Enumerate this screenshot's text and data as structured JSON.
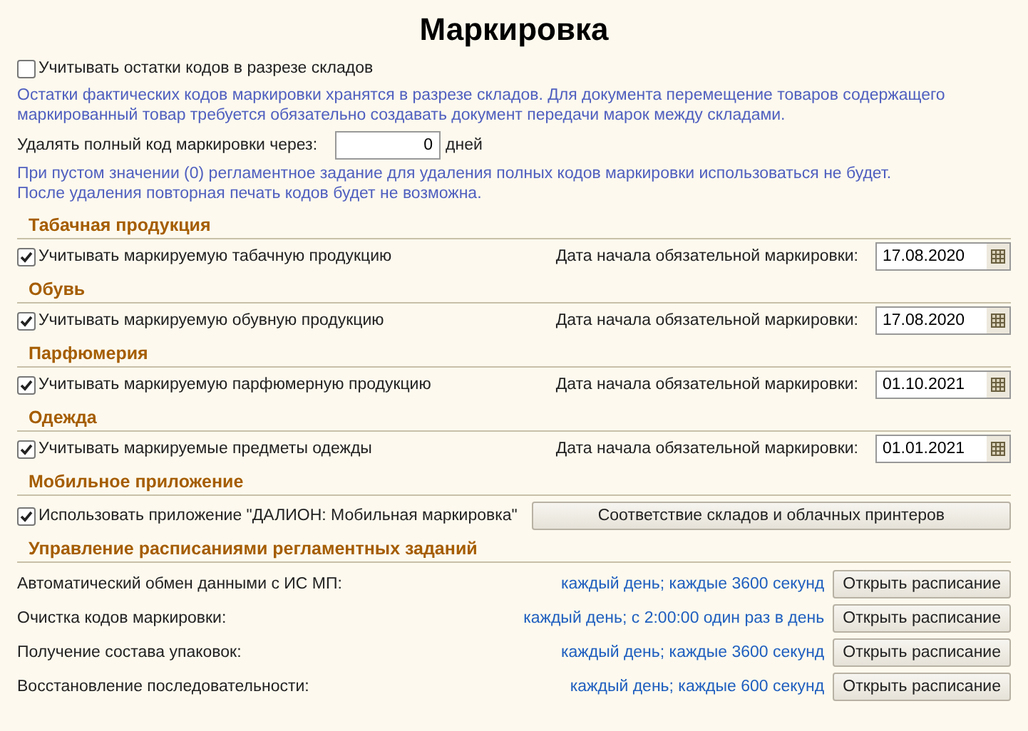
{
  "title": "Маркировка",
  "warehouse_option": {
    "label": "Учитывать остатки кодов в разрезе складов",
    "checked": false
  },
  "warehouse_note": "Остатки фактических кодов маркировки хранятся в разрезе складов. Для документа перемещение товаров содержащего маркированный товар требуется обязательно создавать документ передачи марок между складами.",
  "delete_field": {
    "label": "Удалять полный код маркировки через:",
    "value": "0",
    "unit": "дней"
  },
  "delete_note": [
    "При пустом значении (0) регламентное задание для удаления полных кодов маркировки использоваться не будет.",
    "После удаления повторная печать кодов будет не возможна."
  ],
  "sections": [
    {
      "kind": "product",
      "title": "Табачная продукция",
      "label": "Учитывать маркируемую табачную продукцию",
      "checked": true,
      "date_label": "Дата начала обязательной маркировки:",
      "date": "17.08.2020"
    },
    {
      "kind": "product",
      "title": "Обувь",
      "label": "Учитывать маркируемую обувную продукцию",
      "checked": true,
      "date_label": "Дата начала обязательной маркировки:",
      "date": "17.08.2020"
    },
    {
      "kind": "product",
      "title": "Парфюмерия",
      "label": "Учитывать маркируемую парфюмерную продукцию",
      "checked": true,
      "date_label": "Дата начала обязательной маркировки:",
      "date": "01.10.2021"
    },
    {
      "kind": "product",
      "title": "Одежда",
      "label": "Учитывать маркируемые предметы одежды",
      "checked": true,
      "date_label": "Дата начала обязательной маркировки:",
      "date": "01.01.2021"
    },
    {
      "kind": "mobile",
      "title": "Мобильное приложение",
      "label": "Использовать приложение \"ДАЛИОН: Мобильная маркировка\"",
      "checked": true,
      "button": "Соответствие складов и облачных принтеров"
    },
    {
      "kind": "schedules",
      "title": "Управление расписаниями регламентных заданий",
      "rows": [
        {
          "name": "Автоматический обмен данными с ИС МП:",
          "schedule": "каждый день; каждые 3600 секунд",
          "button": "Открыть расписание"
        },
        {
          "name": "Очистка кодов маркировки:",
          "schedule": "каждый день; с 2:00:00 один раз в день",
          "button": "Открыть расписание"
        },
        {
          "name": "Получение состава упаковок:",
          "schedule": "каждый день; каждые 3600 секунд",
          "button": "Открыть расписание"
        },
        {
          "name": "Восстановление последовательности:",
          "schedule": "каждый день; каждые 600 секунд",
          "button": "Открыть расписание"
        }
      ]
    }
  ]
}
